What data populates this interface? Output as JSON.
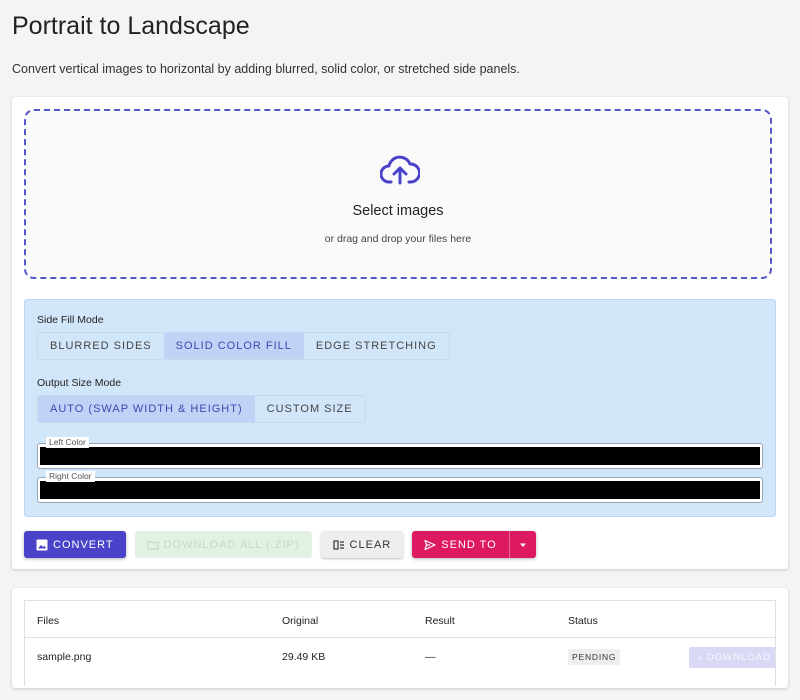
{
  "page": {
    "title": "Portrait to Landscape",
    "description": "Convert vertical images to horizontal by adding blurred, solid color, or stretched side panels."
  },
  "dropzone": {
    "title": "Select images",
    "subtitle": "or drag and drop your files here",
    "icon": "cloud-upload-icon"
  },
  "side_fill": {
    "label": "Side Fill Mode",
    "options": [
      "BLURRED SIDES",
      "SOLID COLOR FILL",
      "EDGE STRETCHING"
    ],
    "selected": "SOLID COLOR FILL"
  },
  "output_size": {
    "label": "Output Size Mode",
    "options": [
      "AUTO (SWAP WIDTH & HEIGHT)",
      "CUSTOM SIZE"
    ],
    "selected": "AUTO (SWAP WIDTH & HEIGHT)"
  },
  "colors": {
    "left_label": "Left Color",
    "left_value": "#000000",
    "right_label": "Right Color",
    "right_value": "#000000"
  },
  "actions": {
    "convert": "CONVERT",
    "download_all": "DOWNLOAD ALL (.ZIP)",
    "clear": "CLEAR",
    "send_to": "SEND TO"
  },
  "files_table": {
    "headers": [
      "Files",
      "Original",
      "Result",
      "Status"
    ],
    "rows": [
      {
        "file": "sample.png",
        "original": "29.49 KB",
        "result": "—",
        "status": "PENDING",
        "action": "DOWNLOAD"
      }
    ]
  },
  "theme": {
    "accent": "#4a43c9",
    "send": "#dd1a61",
    "options_bg": "#d2e6fa"
  }
}
